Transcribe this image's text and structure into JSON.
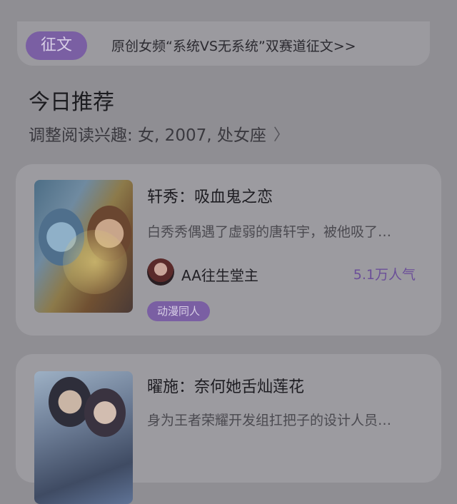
{
  "contest": {
    "tag": "征文",
    "text": "原创女频“系统VS无系统”双赛道征文>>"
  },
  "recommend": {
    "title": "今日推荐",
    "preference": "调整阅读兴趣: 女, 2007, 处女座",
    "chevron_icon": "chevron-right-icon"
  },
  "books": [
    {
      "title": "轩秀：吸血鬼之恋",
      "description": "白秀秀偶遇了虚弱的唐轩宇，被他吸了…",
      "author": "AA往生堂主",
      "popularity": "5.1万人气",
      "genre": "动漫同人"
    },
    {
      "title": "曜施：奈何她舌灿莲花",
      "description": "身为王者荣耀开发组扛把子的设计人员…"
    }
  ],
  "colors": {
    "accent": "#7a5fa3",
    "overlay_background": "#8f8e93"
  }
}
